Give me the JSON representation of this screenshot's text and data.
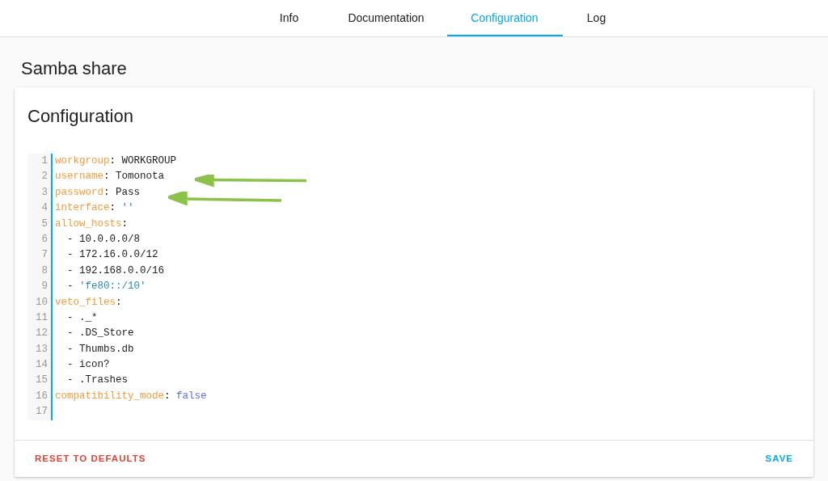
{
  "tabs": [
    {
      "label": "Info",
      "selected": false
    },
    {
      "label": "Documentation",
      "selected": false
    },
    {
      "label": "Configuration",
      "selected": true
    },
    {
      "label": "Log",
      "selected": false
    }
  ],
  "page_title": "Samba share",
  "card": {
    "title": "Configuration",
    "editor_lines": [
      {
        "number": "1",
        "tokens": [
          {
            "kind": "key",
            "text": "workgroup"
          },
          {
            "kind": "plain",
            "text": ": WORKGROUP"
          }
        ]
      },
      {
        "number": "2",
        "tokens": [
          {
            "kind": "key",
            "text": "username"
          },
          {
            "kind": "plain",
            "text": ": Tomonota"
          }
        ]
      },
      {
        "number": "3",
        "tokens": [
          {
            "kind": "key",
            "text": "password"
          },
          {
            "kind": "plain",
            "text": ": Pass"
          }
        ]
      },
      {
        "number": "4",
        "tokens": [
          {
            "kind": "key",
            "text": "interface"
          },
          {
            "kind": "plain",
            "text": ": "
          },
          {
            "kind": "string",
            "text": "''"
          }
        ]
      },
      {
        "number": "5",
        "tokens": [
          {
            "kind": "key",
            "text": "allow_hosts"
          },
          {
            "kind": "plain",
            "text": ":"
          }
        ]
      },
      {
        "number": "6",
        "tokens": [
          {
            "kind": "plain",
            "text": "  - 10.0.0.0/8"
          }
        ]
      },
      {
        "number": "7",
        "tokens": [
          {
            "kind": "plain",
            "text": "  - 172.16.0.0/12"
          }
        ]
      },
      {
        "number": "8",
        "tokens": [
          {
            "kind": "plain",
            "text": "  - 192.168.0.0/16"
          }
        ]
      },
      {
        "number": "9",
        "tokens": [
          {
            "kind": "plain",
            "text": "  - "
          },
          {
            "kind": "string",
            "text": "'fe80::/10'"
          }
        ]
      },
      {
        "number": "10",
        "tokens": [
          {
            "kind": "key",
            "text": "veto_files"
          },
          {
            "kind": "plain",
            "text": ":"
          }
        ]
      },
      {
        "number": "11",
        "tokens": [
          {
            "kind": "plain",
            "text": "  - ._*"
          }
        ]
      },
      {
        "number": "12",
        "tokens": [
          {
            "kind": "plain",
            "text": "  - .DS_Store"
          }
        ]
      },
      {
        "number": "13",
        "tokens": [
          {
            "kind": "plain",
            "text": "  - Thumbs.db"
          }
        ]
      },
      {
        "number": "14",
        "tokens": [
          {
            "kind": "plain",
            "text": "  - icon?"
          }
        ]
      },
      {
        "number": "15",
        "tokens": [
          {
            "kind": "plain",
            "text": "  - .Trashes"
          }
        ]
      },
      {
        "number": "16",
        "tokens": [
          {
            "kind": "key",
            "text": "compatibility_mode"
          },
          {
            "kind": "plain",
            "text": ": "
          },
          {
            "kind": "bool",
            "text": "false"
          }
        ]
      },
      {
        "number": "17"
      }
    ],
    "buttons": [
      {
        "kind": "reset",
        "label": "RESET TO DEFAULTS"
      },
      {
        "kind": "save",
        "label": "SAVE"
      }
    ]
  }
}
